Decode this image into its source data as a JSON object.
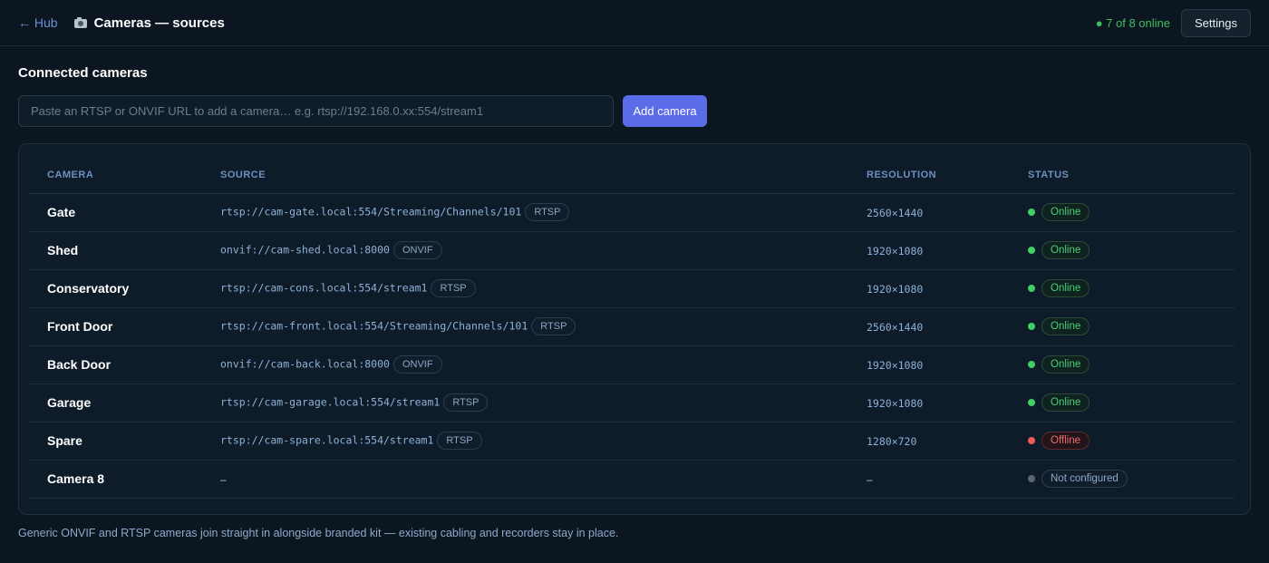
{
  "topbar": {
    "back_label": "← Hub",
    "title_icon": "camera-icon",
    "title": "Cameras — sources",
    "online_status": "● 7 of 8 online",
    "settings_label": "Settings"
  },
  "section": {
    "heading": "Connected cameras",
    "input_placeholder": "Paste an RTSP or ONVIF URL to add a camera… e.g. rtsp://192.168.0.xx:554/stream1",
    "input_value": "",
    "add_label": "Add camera"
  },
  "table": {
    "headers": {
      "camera": "CAMERA",
      "source": "SOURCE",
      "resolution": "RESOLUTION",
      "status": "STATUS"
    },
    "rows": [
      {
        "name": "Gate",
        "source": "rtsp://cam-gate.local:554/Streaming/Channels/101",
        "protocol": "RTSP",
        "resolution": "2560×1440",
        "status": "Online",
        "state": "online"
      },
      {
        "name": "Shed",
        "source": "onvif://cam-shed.local:8000",
        "protocol": "ONVIF",
        "resolution": "1920×1080",
        "status": "Online",
        "state": "online"
      },
      {
        "name": "Conservatory",
        "source": "rtsp://cam-cons.local:554/stream1",
        "protocol": "RTSP",
        "resolution": "1920×1080",
        "status": "Online",
        "state": "online"
      },
      {
        "name": "Front Door",
        "source": "rtsp://cam-front.local:554/Streaming/Channels/101",
        "protocol": "RTSP",
        "resolution": "2560×1440",
        "status": "Online",
        "state": "online"
      },
      {
        "name": "Back Door",
        "source": "onvif://cam-back.local:8000",
        "protocol": "ONVIF",
        "resolution": "1920×1080",
        "status": "Online",
        "state": "online"
      },
      {
        "name": "Garage",
        "source": "rtsp://cam-garage.local:554/stream1",
        "protocol": "RTSP",
        "resolution": "1920×1080",
        "status": "Online",
        "state": "online"
      },
      {
        "name": "Spare",
        "source": "rtsp://cam-spare.local:554/stream1",
        "protocol": "RTSP",
        "resolution": "1280×720",
        "status": "Offline",
        "state": "offline"
      },
      {
        "name": "Camera 8",
        "source": "–",
        "protocol": "",
        "resolution": "–",
        "status": "Not configured",
        "state": "notconf"
      }
    ]
  },
  "status_colors": {
    "online": "#3fcf68",
    "offline": "#ef5a5a",
    "notconf": "#5b6671"
  },
  "footnote": "Generic ONVIF and RTSP cameras join straight in alongside branded kit — existing cabling and recorders stay in place."
}
